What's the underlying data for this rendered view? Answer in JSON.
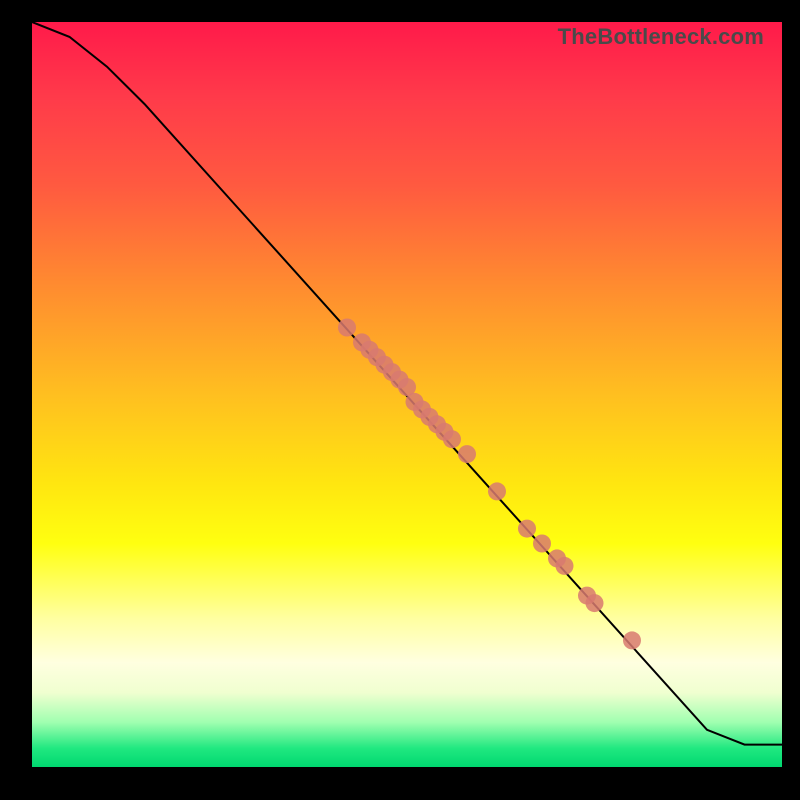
{
  "watermark": "TheBottleneck.com",
  "colors": {
    "dot": "#d87a70",
    "curve": "#000000"
  },
  "chart_data": {
    "type": "line",
    "title": "",
    "xlabel": "",
    "ylabel": "",
    "xlim": [
      0,
      100
    ],
    "ylim": [
      0,
      100
    ],
    "grid": false,
    "curve": {
      "x": [
        0,
        5,
        10,
        15,
        90,
        95,
        100
      ],
      "y": [
        100,
        98,
        94,
        89,
        5,
        3,
        3
      ]
    },
    "points": {
      "x": [
        42,
        44,
        45,
        46,
        47,
        48,
        49,
        50,
        51,
        52,
        53,
        54,
        55,
        56,
        58,
        62,
        66,
        68,
        70,
        71,
        74,
        75,
        80
      ],
      "y": [
        59,
        57,
        56,
        55,
        54,
        53,
        52,
        51,
        49,
        48,
        47,
        46,
        45,
        44,
        42,
        37,
        32,
        30,
        28,
        27,
        23,
        22,
        17
      ]
    }
  }
}
